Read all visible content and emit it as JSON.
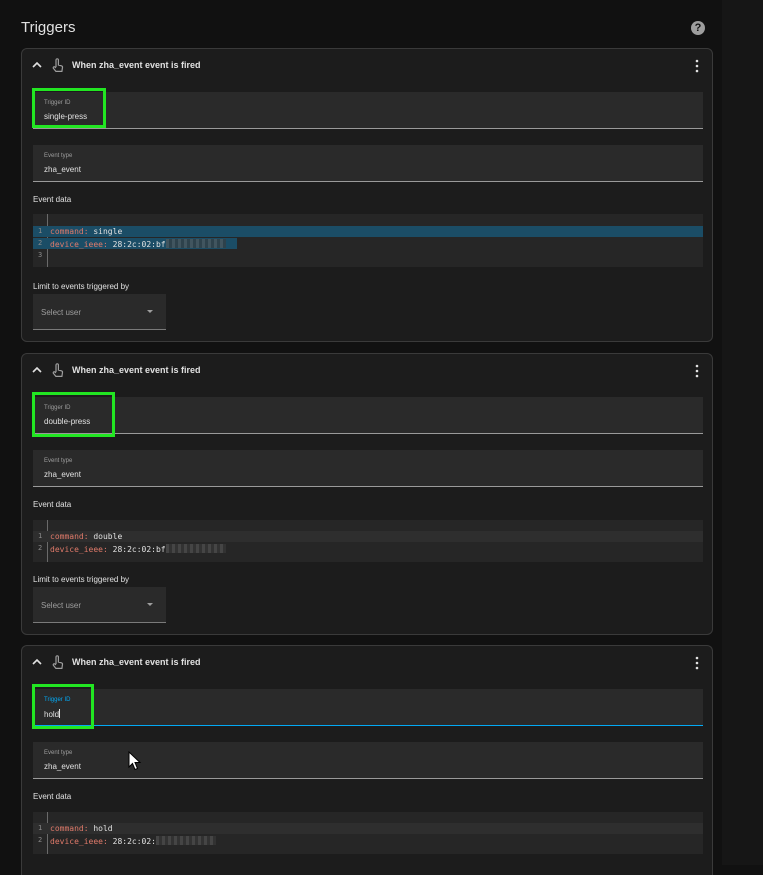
{
  "page": {
    "section_title": "Triggers",
    "help_icon": "help-circle-icon"
  },
  "triggers": [
    {
      "title": "When zha_event event is fired",
      "trigger_id_label": "Trigger ID",
      "trigger_id": "single-press",
      "event_type_label": "Event type",
      "event_type": "zha_event",
      "event_data_label": "Event data",
      "code": [
        {
          "line": "1",
          "key": "command",
          "value": "single"
        },
        {
          "line": "2",
          "key": "device_ieee",
          "value": "28:2c:02:bf"
        },
        {
          "line": "3",
          "key": "",
          "value": ""
        }
      ],
      "limit_label": "Limit to events triggered by",
      "select_placeholder": "Select user"
    },
    {
      "title": "When zha_event event is fired",
      "trigger_id_label": "Trigger ID",
      "trigger_id": "double-press",
      "event_type_label": "Event type",
      "event_type": "zha_event",
      "event_data_label": "Event data",
      "code": [
        {
          "line": "1",
          "key": "command",
          "value": "double"
        },
        {
          "line": "2",
          "key": "device_ieee",
          "value": "28:2c:02:bf"
        }
      ],
      "limit_label": "Limit to events triggered by",
      "select_placeholder": "Select user"
    },
    {
      "title": "When zha_event event is fired",
      "trigger_id_label": "Trigger ID",
      "trigger_id": "hold",
      "event_type_label": "Event type",
      "event_type": "zha_event",
      "event_data_label": "Event data",
      "code": [
        {
          "line": "1",
          "key": "command",
          "value": "hold"
        },
        {
          "line": "2",
          "key": "device_ieee",
          "value": "28:2c:02:"
        }
      ]
    }
  ],
  "colors": {
    "highlight": "#22e622",
    "focus": "#03a9f4",
    "yaml_key": "#e07a6a"
  }
}
